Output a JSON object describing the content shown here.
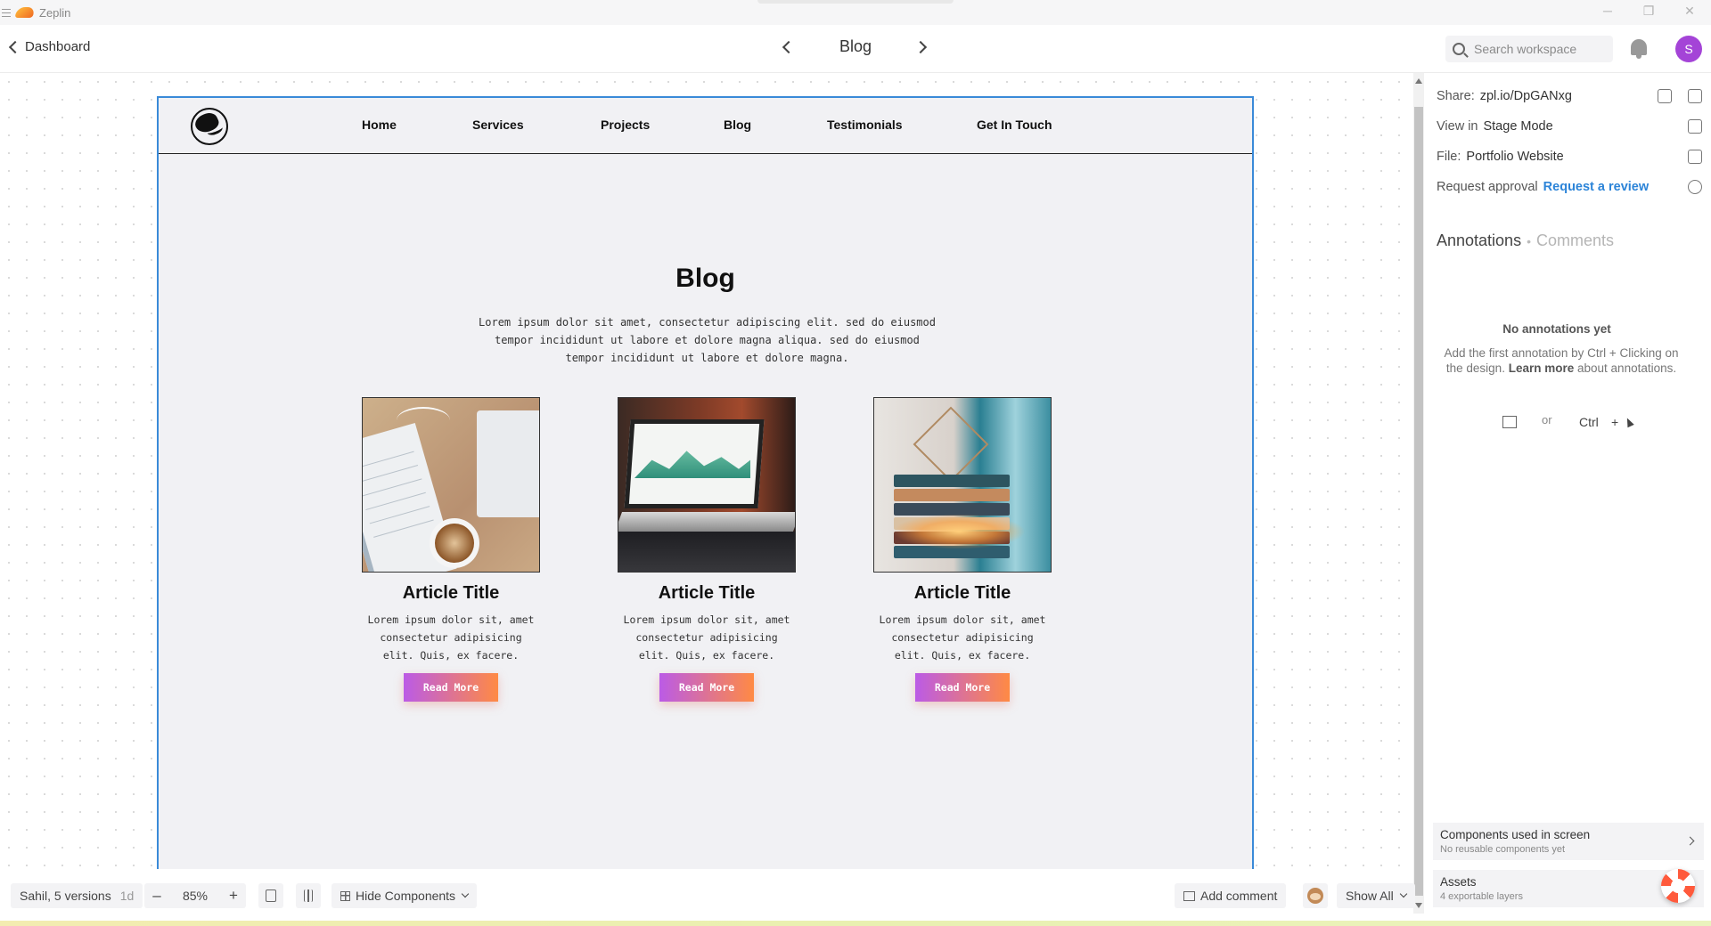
{
  "window": {
    "app_name": "Zeplin"
  },
  "header": {
    "back_label": "Dashboard",
    "screen_title": "Blog",
    "search_placeholder": "Search workspace",
    "avatar_initial": "S"
  },
  "artboard": {
    "nav": [
      "Home",
      "Services",
      "Projects",
      "Blog",
      "Testimonials",
      "Get In Touch"
    ],
    "title": "Blog",
    "intro": "Lorem ipsum dolor sit amet, consectetur adipiscing elit. sed do eiusmod tempor incididunt ut labore et dolore magna aliqua. sed do eiusmod tempor incididunt ut labore et dolore magna.",
    "cards": [
      {
        "title": "Article Title",
        "text": "Lorem ipsum dolor sit, amet consectetur adipisicing elit. Quis, ex facere.",
        "button": "Read More",
        "image": "desk-coffee-keyboard-photo"
      },
      {
        "title": "Article Title",
        "text": "Lorem ipsum dolor sit, amet consectetur adipisicing elit. Quis, ex facere.",
        "button": "Read More",
        "image": "laptop-chart-photo"
      },
      {
        "title": "Article Title",
        "text": "Lorem ipsum dolor sit, amet consectetur adipisicing elit. Quis, ex facere.",
        "button": "Read More",
        "image": "book-stack-lamp-photo"
      }
    ]
  },
  "sidebar": {
    "share_label": "Share:",
    "share_value": "zpl.io/DpGANxg",
    "view_label": "View in",
    "view_value": "Stage Mode",
    "file_label": "File:",
    "file_value": "Portfolio Website",
    "approval_label": "Request approval",
    "approval_link": "Request a review",
    "tab_annotations": "Annotations",
    "tab_separator": "•",
    "tab_comments": "Comments",
    "empty_title": "No annotations yet",
    "empty_text_1": "Add the first annotation by Ctrl + Clicking on the design.",
    "empty_link": "Learn more",
    "empty_text_2": "about annotations.",
    "hint_or": "or",
    "hint_ctrl": "Ctrl",
    "hint_plus": "+",
    "components_title": "Components used in screen",
    "components_sub": "No reusable components yet",
    "assets_title": "Assets",
    "assets_sub": "4 exportable layers"
  },
  "bottombar": {
    "versions": "Sahil, 5 versions",
    "versions_age": "1d",
    "zoom_minus": "–",
    "zoom_value": "85%",
    "zoom_plus": "+",
    "hide_components": "Hide Components",
    "add_comment": "Add comment",
    "show_all": "Show All"
  },
  "colors": {
    "accent": "#2c84d8",
    "avatar": "#a444d7",
    "button_gradient_start": "#bb5be6",
    "button_gradient_end": "#ff8a44",
    "artboard_border": "#3a8ad8"
  }
}
